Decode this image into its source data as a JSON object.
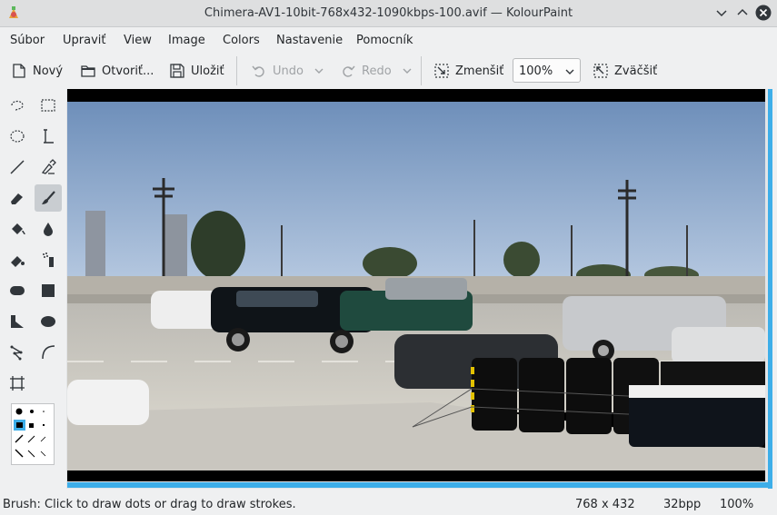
{
  "window": {
    "title": "Chimera-AV1-10bit-768x432-1090kbps-100.avif — KolourPaint"
  },
  "menu": [
    "Súbor",
    "Upraviť",
    "View",
    "Image",
    "Colors",
    "Nastavenie",
    "Pomocník"
  ],
  "toolbar": {
    "new_label": "Nový",
    "open_label": "Otvoriť...",
    "save_label": "Uložiť",
    "undo_label": "Undo",
    "redo_label": "Redo",
    "zoom_out_label": "Zmenšiť",
    "zoom_value": "100%",
    "zoom_in_label": "Zväčšiť"
  },
  "tools": [
    "free-form-selection-icon",
    "rectangular-selection-icon",
    "elliptical-selection-icon",
    "text-icon",
    "line-icon",
    "color-picker-icon",
    "eraser-icon",
    "brush-icon",
    "flood-fill-icon",
    "color-eraser-icon",
    "spraycan-icon",
    "pen-icon",
    "rounded-rectangle-icon",
    "rectangle-icon",
    "polygon-icon",
    "ellipse-icon",
    "polyline-icon",
    "curve-icon",
    "autocrop-icon"
  ],
  "active_tool": "brush-icon",
  "status": {
    "message": "Brush: Click to draw dots or drag to draw strokes.",
    "dimensions": "768 x 432",
    "depth": "32bpp",
    "zoom": "100%"
  },
  "colors": {
    "accent": "#3daee9",
    "window_bg": "#eff0f1"
  }
}
